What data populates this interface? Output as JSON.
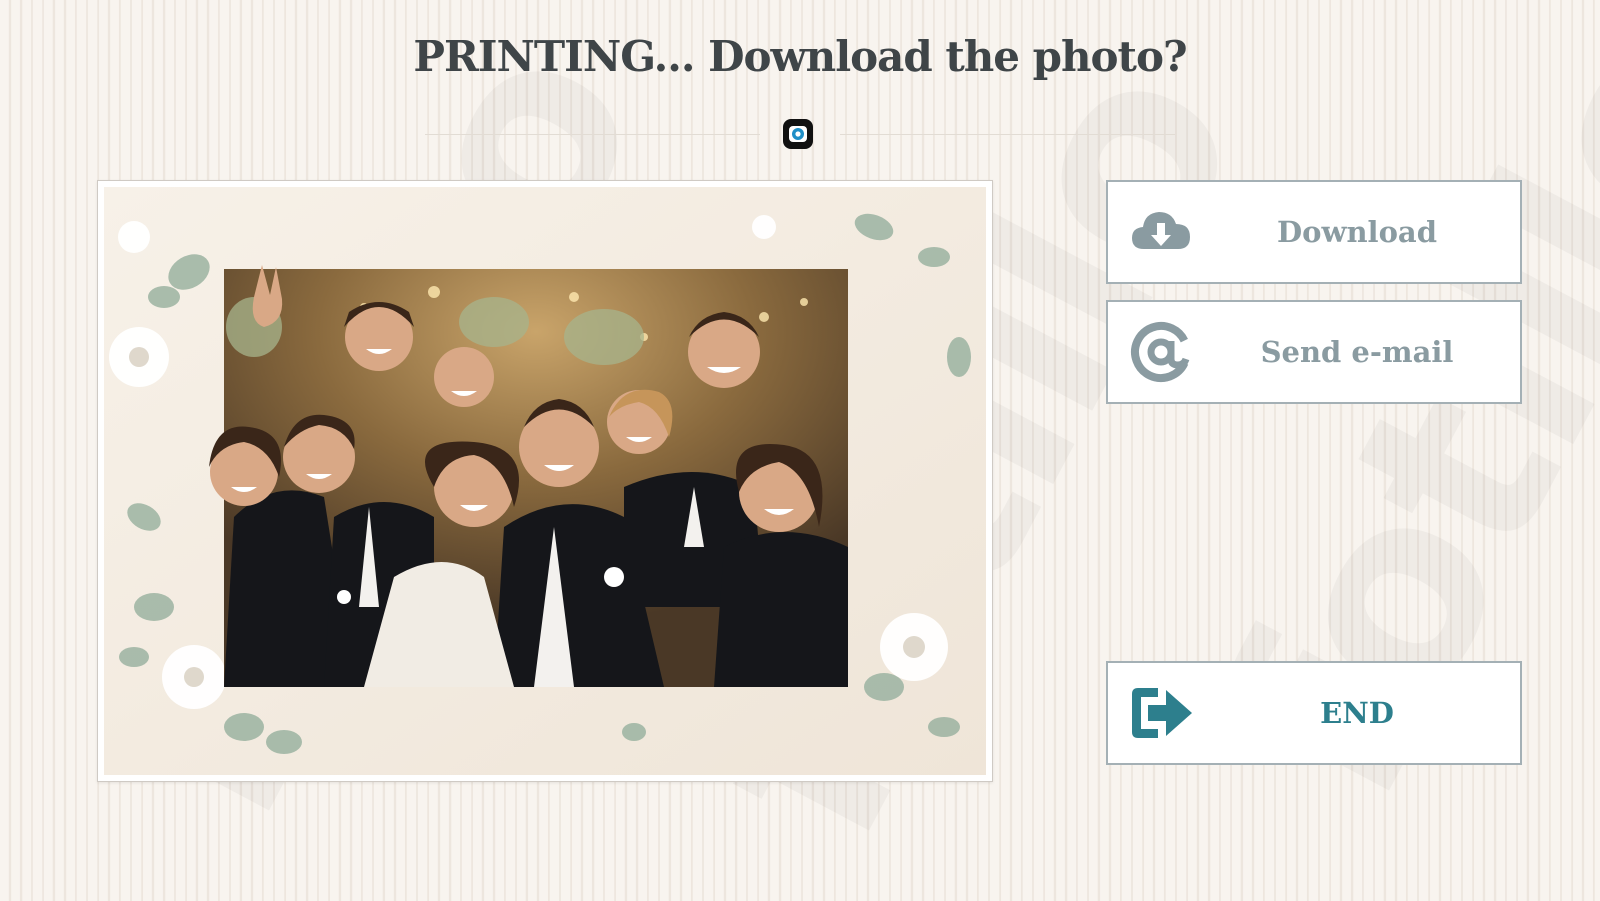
{
  "header": {
    "title": "PRINTING... Download the photo?",
    "center_icon": "camera-logo-icon"
  },
  "photo": {
    "description_icon": "group-photo"
  },
  "actions": {
    "download": {
      "label": "Download",
      "icon": "cloud-download-icon"
    },
    "email": {
      "label": "Send e-mail",
      "icon": "at-sign-icon"
    },
    "end": {
      "label": "END",
      "icon": "exit-arrow-icon"
    }
  },
  "colors": {
    "title": "#3f4548",
    "button_text": "#8a9ba1",
    "accent": "#2d7f8d",
    "button_border": "#a4b0b5"
  }
}
